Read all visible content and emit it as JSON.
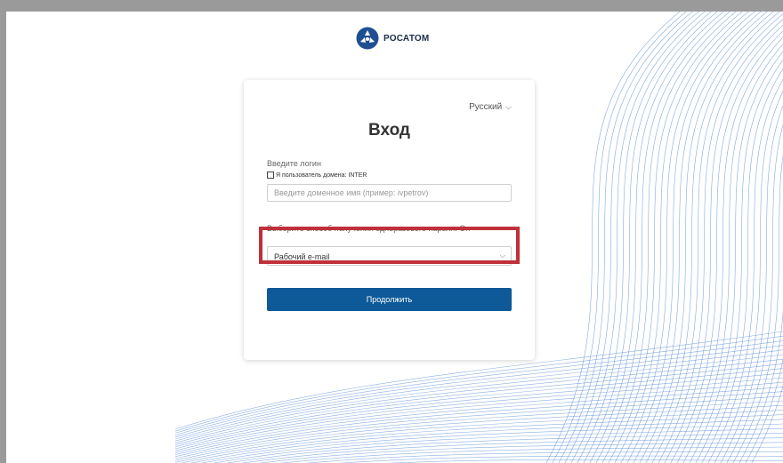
{
  "brand": {
    "name": "РОСАТОМ",
    "logo_icon": "rosatom-atom-icon"
  },
  "login_form": {
    "language": {
      "selected": "Русский"
    },
    "title": "Вход",
    "login": {
      "label": "Введите логин",
      "domain_checkbox_label": "Я пользователь домена: INTER",
      "domain_checkbox_checked": false,
      "input_value": "",
      "placeholder": "Введите доменное имя (пример: ivpetrov)"
    },
    "otp": {
      "label": "Выберите способ получения одноразового пароля. Он",
      "selected": "Рабочий e-mail"
    },
    "continue_label": "Продолжить"
  },
  "colors": {
    "primary_button": "#0e5a98",
    "highlight_border": "#c0303a",
    "wave_lines": "#5b8ed6"
  }
}
